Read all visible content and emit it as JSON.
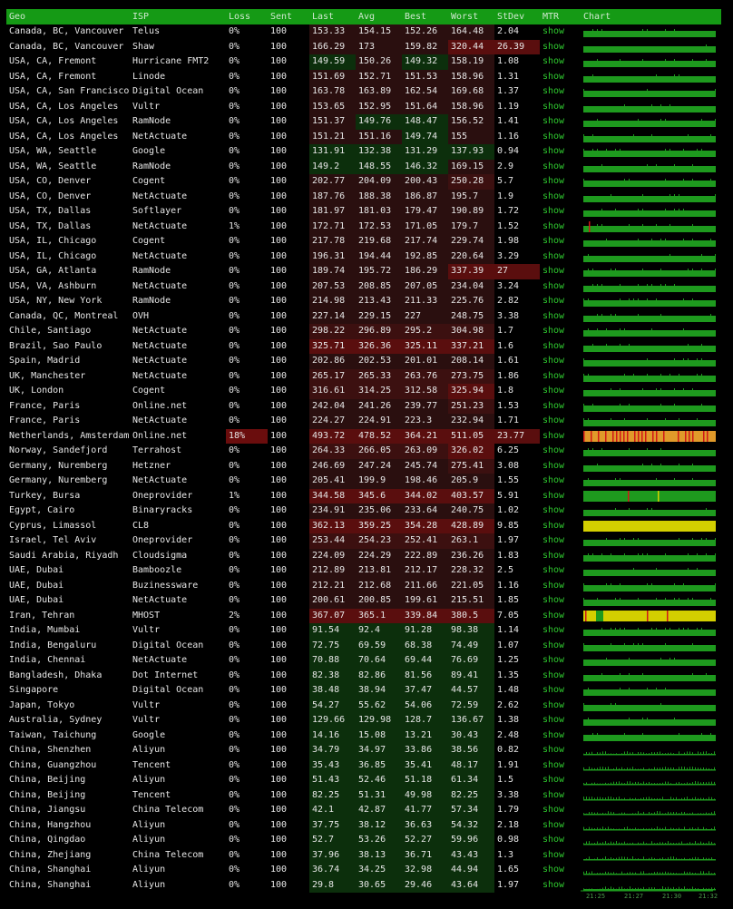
{
  "columns": [
    "Geo",
    "ISP",
    "Loss",
    "Sent",
    "Last",
    "Avg",
    "Best",
    "Worst",
    "StDev",
    "MTR",
    "Chart"
  ],
  "mtr_label": "show",
  "colors": {
    "header": "#159a15",
    "good": "#0c2f0c",
    "mid": "#2a0f0f",
    "bad": "#5a0e0e",
    "ok_bar": "#1e9a1e",
    "loss_bar": "#e09a2a",
    "spike": "#d01818",
    "warn": "#d4cf00"
  },
  "axis_ticks": [
    "21:25",
    "21:27",
    "21:30",
    "21:32"
  ],
  "rows": [
    {
      "geo": "Canada, BC, Vancouver",
      "isp": "Telus",
      "loss": "0%",
      "sent": "100",
      "last": "153.33",
      "avg": "154.15",
      "best": "152.26",
      "worst": "164.48",
      "stdev": "2.04",
      "chart": "ok"
    },
    {
      "geo": "Canada, BC, Vancouver",
      "isp": "Shaw",
      "loss": "0%",
      "sent": "100",
      "last": "166.29",
      "avg": "173",
      "best": "159.82",
      "worst": "320.44",
      "stdev": "26.39",
      "chart": "ok"
    },
    {
      "geo": "USA, CA, Fremont",
      "isp": "Hurricane FMT2",
      "loss": "0%",
      "sent": "100",
      "last": "149.59",
      "avg": "150.26",
      "best": "149.32",
      "worst": "158.19",
      "stdev": "1.08",
      "chart": "ok"
    },
    {
      "geo": "USA, CA, Fremont",
      "isp": "Linode",
      "loss": "0%",
      "sent": "100",
      "last": "151.69",
      "avg": "152.71",
      "best": "151.53",
      "worst": "158.96",
      "stdev": "1.31",
      "chart": "ok"
    },
    {
      "geo": "USA, CA, San Francisco",
      "isp": "Digital Ocean",
      "loss": "0%",
      "sent": "100",
      "last": "163.78",
      "avg": "163.89",
      "best": "162.54",
      "worst": "169.68",
      "stdev": "1.37",
      "chart": "ok"
    },
    {
      "geo": "USA, CA, Los Angeles",
      "isp": "Vultr",
      "loss": "0%",
      "sent": "100",
      "last": "153.65",
      "avg": "152.95",
      "best": "151.64",
      "worst": "158.96",
      "stdev": "1.19",
      "chart": "ok"
    },
    {
      "geo": "USA, CA, Los Angeles",
      "isp": "RamNode",
      "loss": "0%",
      "sent": "100",
      "last": "151.37",
      "avg": "149.76",
      "best": "148.47",
      "worst": "156.52",
      "stdev": "1.41",
      "chart": "ok"
    },
    {
      "geo": "USA, CA, Los Angeles",
      "isp": "NetActuate",
      "loss": "0%",
      "sent": "100",
      "last": "151.21",
      "avg": "151.16",
      "best": "149.74",
      "worst": "155",
      "stdev": "1.16",
      "chart": "ok"
    },
    {
      "geo": "USA, WA, Seattle",
      "isp": "Google",
      "loss": "0%",
      "sent": "100",
      "last": "131.91",
      "avg": "132.38",
      "best": "131.29",
      "worst": "137.93",
      "stdev": "0.94",
      "chart": "ok"
    },
    {
      "geo": "USA, WA, Seattle",
      "isp": "RamNode",
      "loss": "0%",
      "sent": "100",
      "last": "149.2",
      "avg": "148.55",
      "best": "146.32",
      "worst": "169.15",
      "stdev": "2.9",
      "chart": "ok"
    },
    {
      "geo": "USA, CO, Denver",
      "isp": "Cogent",
      "loss": "0%",
      "sent": "100",
      "last": "202.77",
      "avg": "204.09",
      "best": "200.43",
      "worst": "250.28",
      "stdev": "5.7",
      "chart": "ok"
    },
    {
      "geo": "USA, CO, Denver",
      "isp": "NetActuate",
      "loss": "0%",
      "sent": "100",
      "last": "187.76",
      "avg": "188.38",
      "best": "186.87",
      "worst": "195.7",
      "stdev": "1.9",
      "chart": "ok"
    },
    {
      "geo": "USA, TX, Dallas",
      "isp": "Softlayer",
      "loss": "0%",
      "sent": "100",
      "last": "181.97",
      "avg": "181.03",
      "best": "179.47",
      "worst": "190.89",
      "stdev": "1.72",
      "chart": "ok"
    },
    {
      "geo": "USA, TX, Dallas",
      "isp": "NetActuate",
      "loss": "1%",
      "sent": "100",
      "last": "172.71",
      "avg": "172.53",
      "best": "171.05",
      "worst": "179.7",
      "stdev": "1.52",
      "chart": "spike1"
    },
    {
      "geo": "USA, IL, Chicago",
      "isp": "Cogent",
      "loss": "0%",
      "sent": "100",
      "last": "217.78",
      "avg": "219.68",
      "best": "217.74",
      "worst": "229.74",
      "stdev": "1.98",
      "chart": "ok"
    },
    {
      "geo": "USA, IL, Chicago",
      "isp": "NetActuate",
      "loss": "0%",
      "sent": "100",
      "last": "196.31",
      "avg": "194.44",
      "best": "192.85",
      "worst": "220.64",
      "stdev": "3.29",
      "chart": "ok"
    },
    {
      "geo": "USA, GA, Atlanta",
      "isp": "RamNode",
      "loss": "0%",
      "sent": "100",
      "last": "189.74",
      "avg": "195.72",
      "best": "186.29",
      "worst": "337.39",
      "stdev": "27",
      "chart": "ok"
    },
    {
      "geo": "USA, VA, Ashburn",
      "isp": "NetActuate",
      "loss": "0%",
      "sent": "100",
      "last": "207.53",
      "avg": "208.85",
      "best": "207.05",
      "worst": "234.04",
      "stdev": "3.24",
      "chart": "ok"
    },
    {
      "geo": "USA, NY, New York",
      "isp": "RamNode",
      "loss": "0%",
      "sent": "100",
      "last": "214.98",
      "avg": "213.43",
      "best": "211.33",
      "worst": "225.76",
      "stdev": "2.82",
      "chart": "ok"
    },
    {
      "geo": "Canada, QC, Montreal",
      "isp": "OVH",
      "loss": "0%",
      "sent": "100",
      "last": "227.14",
      "avg": "229.15",
      "best": "227",
      "worst": "248.75",
      "stdev": "3.38",
      "chart": "ok"
    },
    {
      "geo": "Chile, Santiago",
      "isp": "NetActuate",
      "loss": "0%",
      "sent": "100",
      "last": "298.22",
      "avg": "296.89",
      "best": "295.2",
      "worst": "304.98",
      "stdev": "1.7",
      "chart": "ok"
    },
    {
      "geo": "Brazil, Sao Paulo",
      "isp": "NetActuate",
      "loss": "0%",
      "sent": "100",
      "last": "325.71",
      "avg": "326.36",
      "best": "325.11",
      "worst": "337.21",
      "stdev": "1.6",
      "chart": "ok"
    },
    {
      "geo": "Spain, Madrid",
      "isp": "NetActuate",
      "loss": "0%",
      "sent": "100",
      "last": "202.86",
      "avg": "202.53",
      "best": "201.01",
      "worst": "208.14",
      "stdev": "1.61",
      "chart": "ok"
    },
    {
      "geo": "UK, Manchester",
      "isp": "NetActuate",
      "loss": "0%",
      "sent": "100",
      "last": "265.17",
      "avg": "265.33",
      "best": "263.76",
      "worst": "273.75",
      "stdev": "1.86",
      "chart": "ok"
    },
    {
      "geo": "UK, London",
      "isp": "Cogent",
      "loss": "0%",
      "sent": "100",
      "last": "316.61",
      "avg": "314.25",
      "best": "312.58",
      "worst": "325.94",
      "stdev": "1.8",
      "chart": "ok"
    },
    {
      "geo": "France, Paris",
      "isp": "Online.net",
      "loss": "0%",
      "sent": "100",
      "last": "242.04",
      "avg": "241.26",
      "best": "239.77",
      "worst": "251.23",
      "stdev": "1.53",
      "chart": "ok"
    },
    {
      "geo": "France, Paris",
      "isp": "NetActuate",
      "loss": "0%",
      "sent": "100",
      "last": "224.27",
      "avg": "224.91",
      "best": "223.3",
      "worst": "232.94",
      "stdev": "1.71",
      "chart": "ok"
    },
    {
      "geo": "Netherlands, Amsterdam",
      "isp": "Online.net",
      "loss": "18%",
      "sent": "100",
      "last": "493.72",
      "avg": "478.52",
      "best": "364.21",
      "worst": "511.05",
      "stdev": "23.77",
      "chart": "lossy"
    },
    {
      "geo": "Norway, Sandefjord",
      "isp": "Terrahost",
      "loss": "0%",
      "sent": "100",
      "last": "264.33",
      "avg": "266.05",
      "best": "263.09",
      "worst": "326.02",
      "stdev": "6.25",
      "chart": "ok"
    },
    {
      "geo": "Germany, Nuremberg",
      "isp": "Hetzner",
      "loss": "0%",
      "sent": "100",
      "last": "246.69",
      "avg": "247.24",
      "best": "245.74",
      "worst": "275.41",
      "stdev": "3.08",
      "chart": "ok"
    },
    {
      "geo": "Germany, Nuremberg",
      "isp": "NetActuate",
      "loss": "0%",
      "sent": "100",
      "last": "205.41",
      "avg": "199.9",
      "best": "198.46",
      "worst": "205.9",
      "stdev": "1.55",
      "chart": "ok"
    },
    {
      "geo": "Turkey, Bursa",
      "isp": "Oneprovider",
      "loss": "1%",
      "sent": "100",
      "last": "344.58",
      "avg": "345.6",
      "best": "344.02",
      "worst": "403.57",
      "stdev": "5.91",
      "chart": "bar_spike"
    },
    {
      "geo": "Egypt, Cairo",
      "isp": "Binaryracks",
      "loss": "0%",
      "sent": "100",
      "last": "234.91",
      "avg": "235.06",
      "best": "233.64",
      "worst": "240.75",
      "stdev": "1.02",
      "chart": "ok"
    },
    {
      "geo": "Cyprus, Limassol",
      "isp": "CL8",
      "loss": "0%",
      "sent": "100",
      "last": "362.13",
      "avg": "359.25",
      "best": "354.28",
      "worst": "428.89",
      "stdev": "9.85",
      "chart": "yellow"
    },
    {
      "geo": "Israel, Tel Aviv",
      "isp": "Oneprovider",
      "loss": "0%",
      "sent": "100",
      "last": "253.44",
      "avg": "254.23",
      "best": "252.41",
      "worst": "263.1",
      "stdev": "1.97",
      "chart": "ok"
    },
    {
      "geo": "Saudi Arabia, Riyadh",
      "isp": "Cloudsigma",
      "loss": "0%",
      "sent": "100",
      "last": "224.09",
      "avg": "224.29",
      "best": "222.89",
      "worst": "236.26",
      "stdev": "1.83",
      "chart": "ok"
    },
    {
      "geo": "UAE, Dubai",
      "isp": "Bamboozle",
      "loss": "0%",
      "sent": "100",
      "last": "212.89",
      "avg": "213.81",
      "best": "212.17",
      "worst": "228.32",
      "stdev": "2.5",
      "chart": "ok"
    },
    {
      "geo": "UAE, Dubai",
      "isp": "Buzinessware",
      "loss": "0%",
      "sent": "100",
      "last": "212.21",
      "avg": "212.68",
      "best": "211.66",
      "worst": "221.05",
      "stdev": "1.16",
      "chart": "ok"
    },
    {
      "geo": "UAE, Dubai",
      "isp": "NetActuate",
      "loss": "0%",
      "sent": "100",
      "last": "200.61",
      "avg": "200.85",
      "best": "199.61",
      "worst": "215.51",
      "stdev": "1.85",
      "chart": "ok"
    },
    {
      "geo": "Iran, Tehran",
      "isp": "MHOST",
      "loss": "2%",
      "sent": "100",
      "last": "367.07",
      "avg": "365.1",
      "best": "339.84",
      "worst": "380.5",
      "stdev": "7.05",
      "chart": "yellow_mixed"
    },
    {
      "geo": "India, Mumbai",
      "isp": "Vultr",
      "loss": "0%",
      "sent": "100",
      "last": "91.54",
      "avg": "92.4",
      "best": "91.28",
      "worst": "98.38",
      "stdev": "1.14",
      "chart": "ok"
    },
    {
      "geo": "India, Bengaluru",
      "isp": "Digital Ocean",
      "loss": "0%",
      "sent": "100",
      "last": "72.75",
      "avg": "69.59",
      "best": "68.38",
      "worst": "74.49",
      "stdev": "1.07",
      "chart": "ok"
    },
    {
      "geo": "India, Chennai",
      "isp": "NetActuate",
      "loss": "0%",
      "sent": "100",
      "last": "70.88",
      "avg": "70.64",
      "best": "69.44",
      "worst": "76.69",
      "stdev": "1.25",
      "chart": "ok"
    },
    {
      "geo": "Bangladesh, Dhaka",
      "isp": "Dot Internet",
      "loss": "0%",
      "sent": "100",
      "last": "82.38",
      "avg": "82.86",
      "best": "81.56",
      "worst": "89.41",
      "stdev": "1.35",
      "chart": "ok"
    },
    {
      "geo": "Singapore",
      "isp": "Digital Ocean",
      "loss": "0%",
      "sent": "100",
      "last": "38.48",
      "avg": "38.94",
      "best": "37.47",
      "worst": "44.57",
      "stdev": "1.48",
      "chart": "ok"
    },
    {
      "geo": "Japan, Tokyo",
      "isp": "Vultr",
      "loss": "0%",
      "sent": "100",
      "last": "54.27",
      "avg": "55.62",
      "best": "54.06",
      "worst": "72.59",
      "stdev": "2.62",
      "chart": "ok"
    },
    {
      "geo": "Australia, Sydney",
      "isp": "Vultr",
      "loss": "0%",
      "sent": "100",
      "last": "129.66",
      "avg": "129.98",
      "best": "128.7",
      "worst": "136.67",
      "stdev": "1.38",
      "chart": "ok"
    },
    {
      "geo": "Taiwan, Taichung",
      "isp": "Google",
      "loss": "0%",
      "sent": "100",
      "last": "14.16",
      "avg": "15.08",
      "best": "13.21",
      "worst": "30.43",
      "stdev": "2.48",
      "chart": "ok"
    },
    {
      "geo": "China, Shenzhen",
      "isp": "Aliyun",
      "loss": "0%",
      "sent": "100",
      "last": "34.79",
      "avg": "34.97",
      "best": "33.86",
      "worst": "38.56",
      "stdev": "0.82",
      "chart": "thin"
    },
    {
      "geo": "China, Guangzhou",
      "isp": "Tencent",
      "loss": "0%",
      "sent": "100",
      "last": "35.43",
      "avg": "36.85",
      "best": "35.41",
      "worst": "48.17",
      "stdev": "1.91",
      "chart": "thin"
    },
    {
      "geo": "China, Beijing",
      "isp": "Aliyun",
      "loss": "0%",
      "sent": "100",
      "last": "51.43",
      "avg": "52.46",
      "best": "51.18",
      "worst": "61.34",
      "stdev": "1.5",
      "chart": "thin"
    },
    {
      "geo": "China, Beijing",
      "isp": "Tencent",
      "loss": "0%",
      "sent": "100",
      "last": "82.25",
      "avg": "51.31",
      "best": "49.98",
      "worst": "82.25",
      "stdev": "3.38",
      "chart": "thin"
    },
    {
      "geo": "China, Jiangsu",
      "isp": "China Telecom",
      "loss": "0%",
      "sent": "100",
      "last": "42.1",
      "avg": "42.87",
      "best": "41.77",
      "worst": "57.34",
      "stdev": "1.79",
      "chart": "thin"
    },
    {
      "geo": "China, Hangzhou",
      "isp": "Aliyun",
      "loss": "0%",
      "sent": "100",
      "last": "37.75",
      "avg": "38.12",
      "best": "36.63",
      "worst": "54.32",
      "stdev": "2.18",
      "chart": "thin"
    },
    {
      "geo": "China, Qingdao",
      "isp": "Aliyun",
      "loss": "0%",
      "sent": "100",
      "last": "52.7",
      "avg": "53.26",
      "best": "52.27",
      "worst": "59.96",
      "stdev": "0.98",
      "chart": "thin"
    },
    {
      "geo": "China, Zhejiang",
      "isp": "China Telecom",
      "loss": "0%",
      "sent": "100",
      "last": "37.96",
      "avg": "38.13",
      "best": "36.71",
      "worst": "43.43",
      "stdev": "1.3",
      "chart": "thin"
    },
    {
      "geo": "China, Shanghai",
      "isp": "Aliyun",
      "loss": "0%",
      "sent": "100",
      "last": "36.74",
      "avg": "34.25",
      "best": "32.98",
      "worst": "44.94",
      "stdev": "1.65",
      "chart": "thin"
    },
    {
      "geo": "China, Shanghai",
      "isp": "Aliyun",
      "loss": "0%",
      "sent": "100",
      "last": "29.8",
      "avg": "30.65",
      "best": "29.46",
      "worst": "43.64",
      "stdev": "1.97",
      "chart": "thin"
    }
  ]
}
